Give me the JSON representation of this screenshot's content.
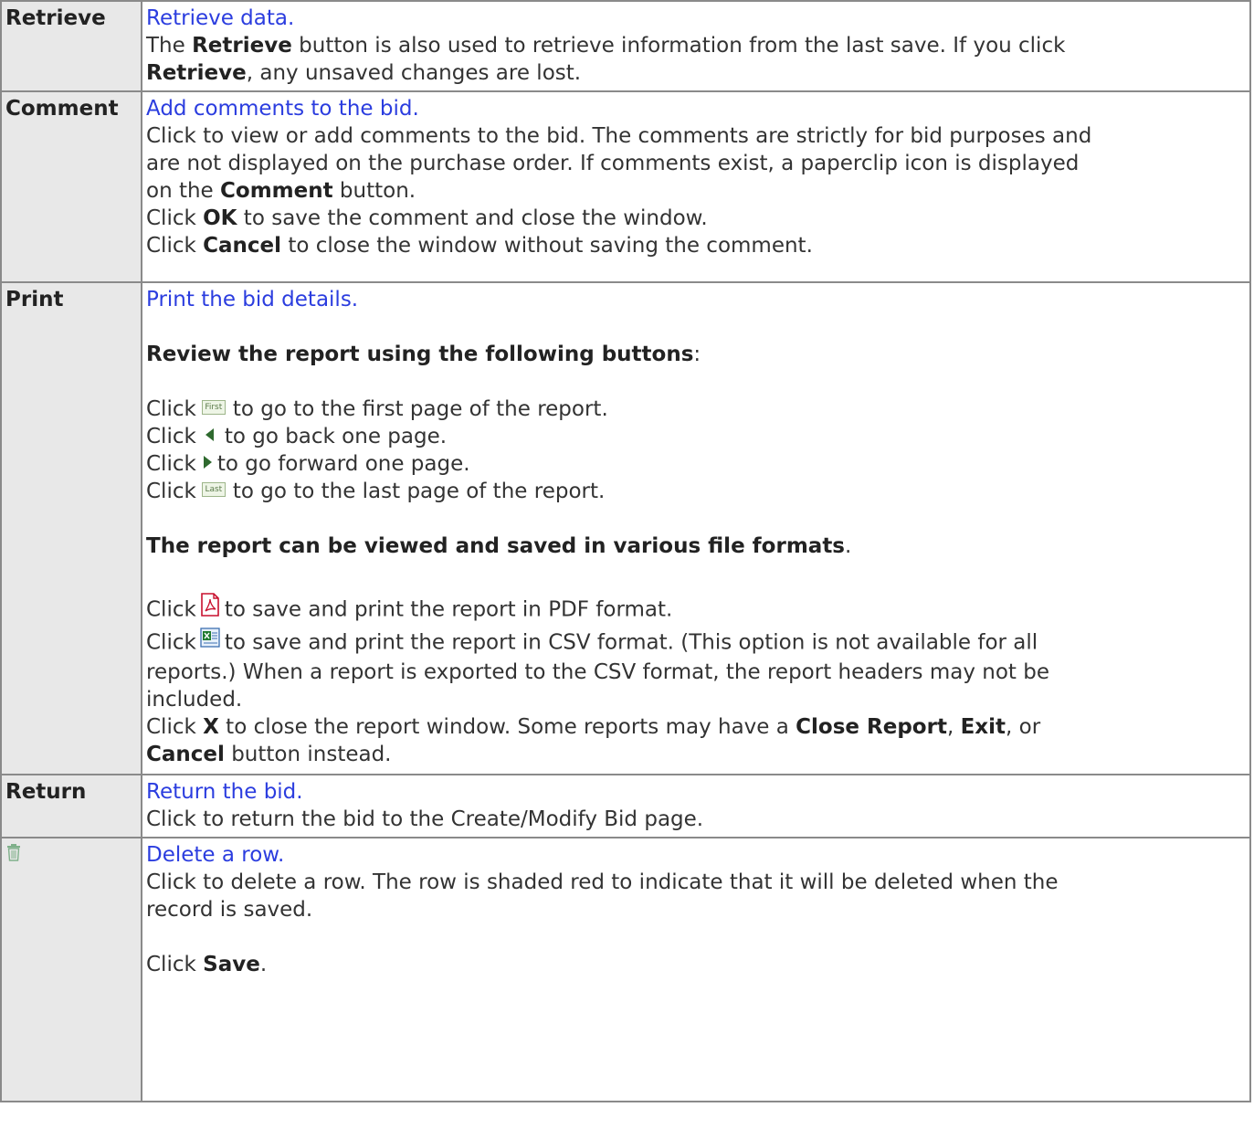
{
  "rows": [
    {
      "key": "Retrieve",
      "link": "Retrieve data.",
      "lines": [
        [
          "The ",
          "Retrieve",
          " button is also used to retrieve information from the last save. If you click"
        ],
        [
          "",
          "Retrieve",
          ", any unsaved changes are lost."
        ]
      ]
    },
    {
      "key": "Comment",
      "link": "Add comments to the bid.",
      "lines": [
        "Click to view or add comments to the bid. The comments are strictly for bid purposes and",
        "are not displayed on the purchase order. If comments exist, a paperclip icon is displayed",
        [
          "on the ",
          "Comment",
          " button."
        ],
        [
          "Click ",
          "OK",
          " to save the comment and close the window."
        ],
        [
          "Click ",
          "Cancel",
          " to close the window without saving the comment."
        ]
      ]
    },
    {
      "key": "Print",
      "link": "Print the bid details.",
      "review_header": "Review the report using the following buttons",
      "review_header_suffix": ":",
      "nav": {
        "click": "Click",
        "first_label": "First",
        "first_text": "to go to the first page of the report.",
        "back_text": "to go back one page.",
        "forward_text": "to go forward one page.",
        "last_label": "Last",
        "last_text": "to go to the last page of the report."
      },
      "formats_header": "The report can be viewed and saved in various file formats",
      "formats_header_suffix": ".",
      "pdf_text": "to save and print the report in PDF format.",
      "csv_lines": [
        "to save and print the report in CSV format. (This option is not available for all",
        "reports.) When a report is exported to the CSV format, the report headers may not be",
        "included."
      ],
      "close_line1": [
        "Click ",
        "X",
        " to close the report window. Some reports may have a ",
        "Close Report",
        ", ",
        "Exit",
        ", or"
      ],
      "close_line2": [
        "",
        "Cancel",
        " button instead."
      ]
    },
    {
      "key": "Return",
      "link": "Return the bid.",
      "lines": [
        "Click to return the bid to the Create/Modify Bid page."
      ]
    },
    {
      "key_icon": "trash-icon",
      "link": "Delete a row.",
      "lines": [
        "Click to delete a row. The row is shaded red to indicate that it will be deleted when the",
        "record is saved."
      ],
      "save_line": [
        "Click ",
        "Save",
        "."
      ]
    }
  ],
  "colors": {
    "link": "#2b3ddf",
    "border": "#8a8a8a",
    "key_bg": "#e8e8e8"
  }
}
